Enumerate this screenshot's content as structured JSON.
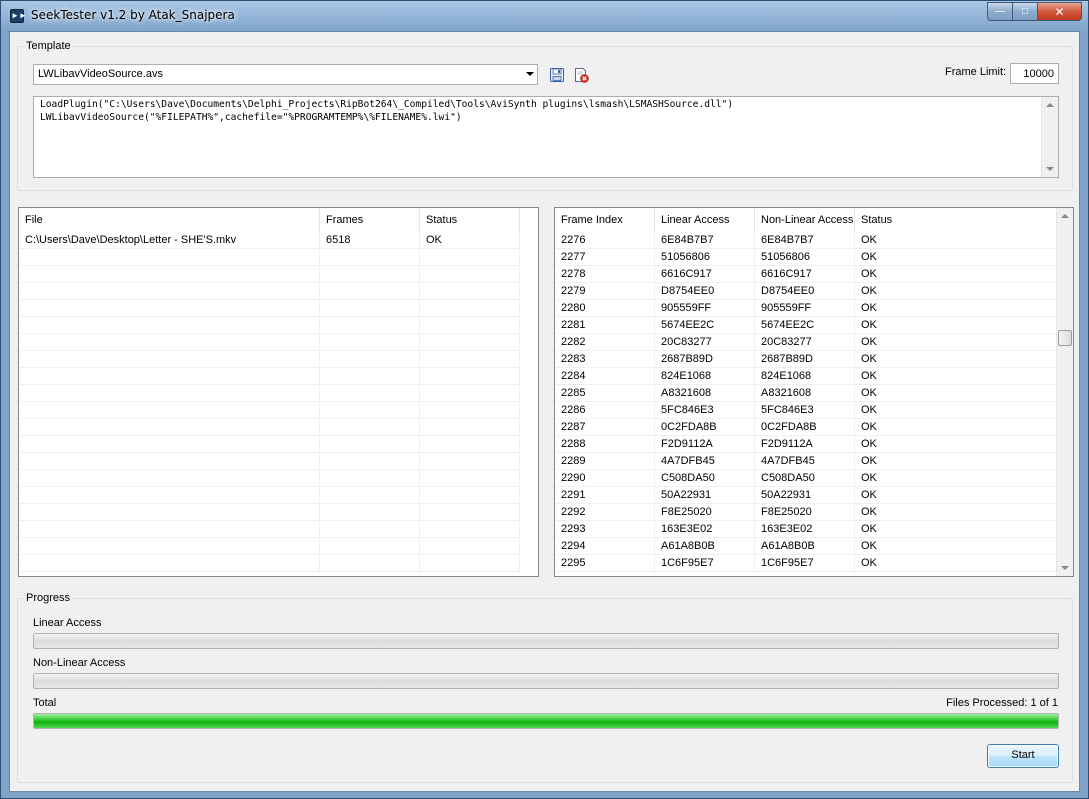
{
  "window": {
    "title": "SeekTester v1.2 by Atak_Snajpera"
  },
  "template": {
    "group_label": "Template",
    "selected": "LWLibavVideoSource.avs",
    "frame_limit_label": "Frame Limit:",
    "frame_limit_value": "10000",
    "script_lines": [
      "LoadPlugin(\"C:\\Users\\Dave\\Documents\\Delphi_Projects\\RipBot264\\_Compiled\\Tools\\AviSynth plugins\\lsmash\\LSMASHSource.dll\")",
      "LWLibavVideoSource(\"%FILEPATH%\",cachefile=\"%PROGRAMTEMP%\\%FILENAME%.lwi\")"
    ]
  },
  "files_list": {
    "columns": [
      "File",
      "Frames",
      "Status"
    ],
    "rows": [
      [
        "C:\\Users\\Dave\\Desktop\\Letter - SHE'S.mkv",
        "6518",
        "OK"
      ]
    ]
  },
  "frames_list": {
    "columns": [
      "Frame Index",
      "Linear Access",
      "Non-Linear Access",
      "Status"
    ],
    "scroll_fraction": 0.33,
    "rows": [
      [
        "2276",
        "6E84B7B7",
        "6E84B7B7",
        "OK"
      ],
      [
        "2277",
        "51056806",
        "51056806",
        "OK"
      ],
      [
        "2278",
        "6616C917",
        "6616C917",
        "OK"
      ],
      [
        "2279",
        "D8754EE0",
        "D8754EE0",
        "OK"
      ],
      [
        "2280",
        "905559FF",
        "905559FF",
        "OK"
      ],
      [
        "2281",
        "5674EE2C",
        "5674EE2C",
        "OK"
      ],
      [
        "2282",
        "20C83277",
        "20C83277",
        "OK"
      ],
      [
        "2283",
        "2687B89D",
        "2687B89D",
        "OK"
      ],
      [
        "2284",
        "824E1068",
        "824E1068",
        "OK"
      ],
      [
        "2285",
        "A8321608",
        "A8321608",
        "OK"
      ],
      [
        "2286",
        "5FC846E3",
        "5FC846E3",
        "OK"
      ],
      [
        "2287",
        "0C2FDA8B",
        "0C2FDA8B",
        "OK"
      ],
      [
        "2288",
        "F2D9112A",
        "F2D9112A",
        "OK"
      ],
      [
        "2289",
        "4A7DFB45",
        "4A7DFB45",
        "OK"
      ],
      [
        "2290",
        "C508DA50",
        "C508DA50",
        "OK"
      ],
      [
        "2291",
        "50A22931",
        "50A22931",
        "OK"
      ],
      [
        "2292",
        "F8E25020",
        "F8E25020",
        "OK"
      ],
      [
        "2293",
        "163E3E02",
        "163E3E02",
        "OK"
      ],
      [
        "2294",
        "A61A8B0B",
        "A61A8B0B",
        "OK"
      ],
      [
        "2295",
        "1C6F95E7",
        "1C6F95E7",
        "OK"
      ]
    ]
  },
  "progress": {
    "group_label": "Progress",
    "linear_label": "Linear Access",
    "linear_fraction": 0,
    "nonlinear_label": "Non-Linear Access",
    "nonlinear_fraction": 0,
    "total_label": "Total",
    "total_fraction": 1,
    "files_processed": "Files Processed: 1 of 1"
  },
  "actions": {
    "start_label": "Start"
  },
  "colors": {
    "progress_green": "#0cb40c",
    "button_border": "#3c7fb1"
  },
  "icons": {
    "save": "save-icon",
    "delete": "delete-icon"
  }
}
